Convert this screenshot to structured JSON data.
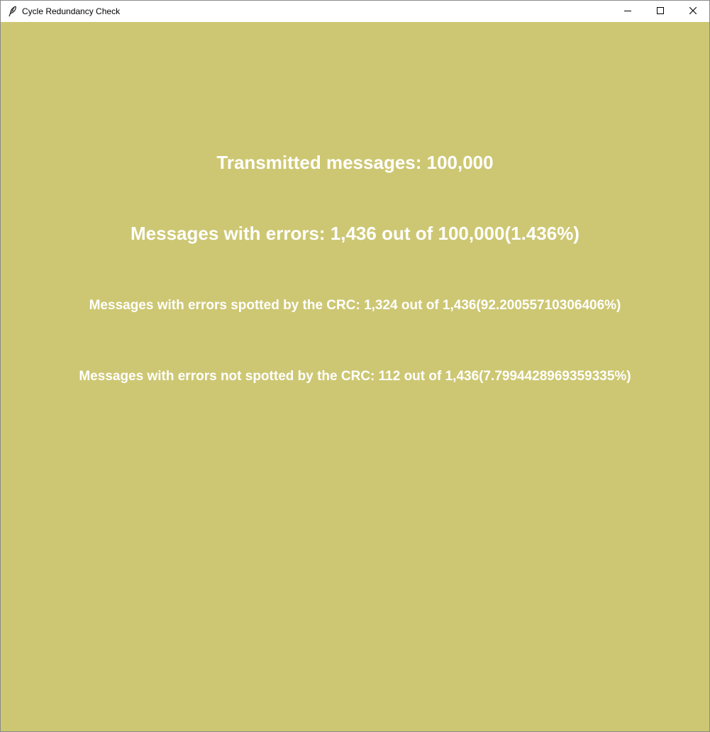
{
  "window": {
    "title": "Cycle Redundancy Check",
    "icon": "feather-icon",
    "controls": {
      "minimize": "minimize-icon",
      "maximize": "maximize-icon",
      "close": "close-icon"
    }
  },
  "content": {
    "background_color": "#cdc773",
    "text_color": "#ffffff",
    "transmitted": "Transmitted messages: 100,000",
    "errors": "Messages with errors: 1,436 out of 100,000(1.436%)",
    "spotted": "Messages with errors spotted by the CRC: 1,324 out of 1,436(92.20055710306406%)",
    "not_spotted": "Messages with errors not spotted by the CRC: 112 out of 1,436(7.7994428969359335%)"
  }
}
